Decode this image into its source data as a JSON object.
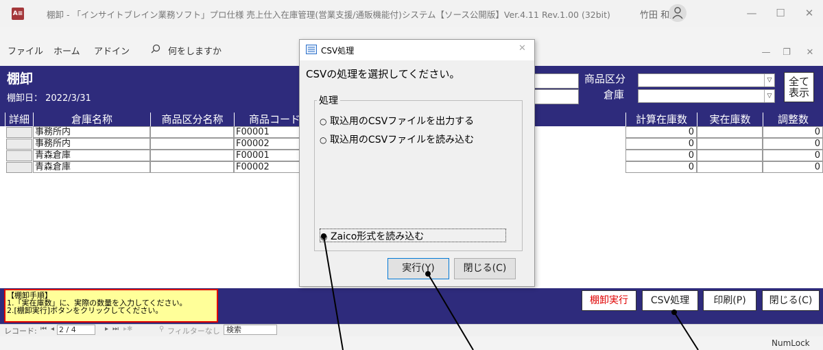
{
  "app": {
    "icon_label": "A≡",
    "title": "棚卸 - 「インサイトブレイン業務ソフト」プロ仕様 売上仕入在庫管理(営業支援/通販機能付)システム【ソース公開版】Ver.4.11 Rev.1.00 (32bit)",
    "user_name": "竹田 和彦",
    "window_controls": [
      "—",
      "☐",
      "✕"
    ],
    "doc_controls": [
      "—",
      "❐",
      "✕"
    ]
  },
  "ribbon": {
    "tabs": [
      "ファイル",
      "ホーム",
      "アドイン"
    ],
    "search_placeholder": "何をしますか"
  },
  "form": {
    "title": "棚卸",
    "date_label": "棚卸日： 2022/3/31",
    "category_label": "商品区分",
    "warehouse_label": "倉庫",
    "show_all_line1": "全て",
    "show_all_line2": "表示"
  },
  "grid": {
    "headers": [
      "詳細",
      "倉庫名称",
      "商品区分名称",
      "商品コード",
      "計算在庫数",
      "実在庫数",
      "調整数"
    ],
    "rows": [
      {
        "warehouse": "事務所内",
        "category": "",
        "code": "F00001",
        "calc": "0",
        "actual": "",
        "adjust": "0"
      },
      {
        "warehouse": "事務所内",
        "category": "",
        "code": "F00002",
        "calc": "0",
        "actual": "",
        "adjust": "0"
      },
      {
        "warehouse": "青森倉庫",
        "category": "",
        "code": "F00001",
        "calc": "0",
        "actual": "",
        "adjust": "0"
      },
      {
        "warehouse": "青森倉庫",
        "category": "",
        "code": "F00002",
        "calc": "0",
        "actual": "",
        "adjust": "0"
      }
    ]
  },
  "instructions": {
    "title": "【棚卸手順】",
    "line1": "1.「実在庫数」に、実際の数量を入力してください。",
    "line2": "2.[棚卸実行]ボタンをクリックしてください。"
  },
  "footer_buttons": {
    "execute": "棚卸実行",
    "csv": "CSV処理",
    "print": "印刷(P)",
    "close": "閉じる(C)"
  },
  "nav": {
    "record_label": "レコード:",
    "record_value": "2 / 4",
    "filter": "フィルターなし",
    "search": "検索"
  },
  "status": {
    "numlock": "NumLock"
  },
  "dialog": {
    "title": "CSV処理",
    "prompt": "CSVの処理を選択してください。",
    "group_label": "処理",
    "options": [
      {
        "label": "取込用のCSVファイルを出力する",
        "selected": false
      },
      {
        "label": "取込用のCSVファイルを読み込む",
        "selected": false
      },
      {
        "label": "Zaico形式を読み込む",
        "selected": true
      }
    ],
    "execute_button": "実行(Y)",
    "close_button": "閉じる(C)"
  },
  "colors": {
    "form_navy": "#2e2b7c",
    "instructions_bg": "#ffff99",
    "instructions_border": "#e00000",
    "execute_text": "#e00000"
  }
}
